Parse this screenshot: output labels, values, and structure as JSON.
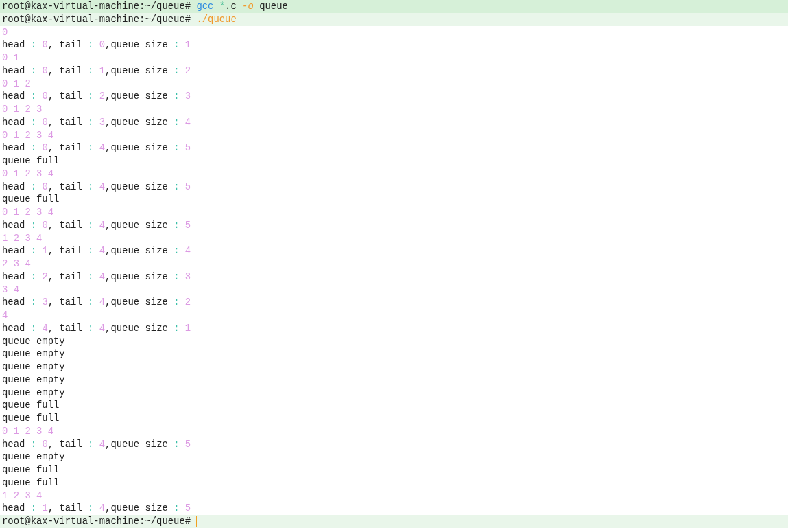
{
  "lines": [
    {
      "kind": "prompt",
      "prompt": "root@kax-virtual-machine:~/queue#",
      "highlighted": true,
      "cursor": false,
      "command": [
        {
          "text": " gcc",
          "kind": "program"
        },
        {
          "text": " *",
          "kind": "glob"
        },
        {
          "text": ".c",
          "kind": "plain"
        },
        {
          "text": " -o",
          "kind": "flag"
        },
        {
          "text": " queue",
          "kind": "plain"
        }
      ]
    },
    {
      "kind": "prompt",
      "prompt": "root@kax-virtual-machine:~/queue#",
      "highlighted": false,
      "cursor": false,
      "command": [
        {
          "text": " ./queue",
          "kind": "path"
        }
      ]
    },
    {
      "kind": "numbers",
      "text": "0"
    },
    {
      "kind": "status",
      "text": "head : 0, tail : 0,queue size : 1"
    },
    {
      "kind": "numbers",
      "text": "0 1"
    },
    {
      "kind": "status",
      "text": "head : 0, tail : 1,queue size : 2"
    },
    {
      "kind": "numbers",
      "text": "0 1 2"
    },
    {
      "kind": "status",
      "text": "head : 0, tail : 2,queue size : 3"
    },
    {
      "kind": "numbers",
      "text": "0 1 2 3"
    },
    {
      "kind": "status",
      "text": "head : 0, tail : 3,queue size : 4"
    },
    {
      "kind": "numbers",
      "text": "0 1 2 3 4"
    },
    {
      "kind": "status",
      "text": "head : 0, tail : 4,queue size : 5"
    },
    {
      "kind": "message",
      "text": "queue full"
    },
    {
      "kind": "numbers",
      "text": "0 1 2 3 4"
    },
    {
      "kind": "status",
      "text": "head : 0, tail : 4,queue size : 5"
    },
    {
      "kind": "message",
      "text": "queue full"
    },
    {
      "kind": "numbers",
      "text": "0 1 2 3 4"
    },
    {
      "kind": "status",
      "text": "head : 0, tail : 4,queue size : 5"
    },
    {
      "kind": "numbers",
      "text": "1 2 3 4"
    },
    {
      "kind": "status",
      "text": "head : 1, tail : 4,queue size : 4"
    },
    {
      "kind": "numbers",
      "text": "2 3 4"
    },
    {
      "kind": "status",
      "text": "head : 2, tail : 4,queue size : 3"
    },
    {
      "kind": "numbers",
      "text": "3 4"
    },
    {
      "kind": "status",
      "text": "head : 3, tail : 4,queue size : 2"
    },
    {
      "kind": "numbers",
      "text": "4"
    },
    {
      "kind": "status",
      "text": "head : 4, tail : 4,queue size : 1"
    },
    {
      "kind": "message",
      "text": "queue empty"
    },
    {
      "kind": "message",
      "text": "queue empty"
    },
    {
      "kind": "message",
      "text": "queue empty"
    },
    {
      "kind": "message",
      "text": "queue empty"
    },
    {
      "kind": "message",
      "text": "queue empty"
    },
    {
      "kind": "message",
      "text": "queue full"
    },
    {
      "kind": "message",
      "text": "queue full"
    },
    {
      "kind": "numbers",
      "text": "0 1 2 3 4"
    },
    {
      "kind": "status",
      "text": "head : 0, tail : 4,queue size : 5"
    },
    {
      "kind": "message",
      "text": "queue empty"
    },
    {
      "kind": "message",
      "text": "queue full"
    },
    {
      "kind": "message",
      "text": "queue full"
    },
    {
      "kind": "numbers",
      "text": "1 2 3 4"
    },
    {
      "kind": "status",
      "text": "head : 1, tail : 4,queue size : 5"
    },
    {
      "kind": "prompt",
      "prompt": "root@kax-virtual-machine:~/queue#",
      "highlighted": false,
      "cursor": true
    }
  ]
}
